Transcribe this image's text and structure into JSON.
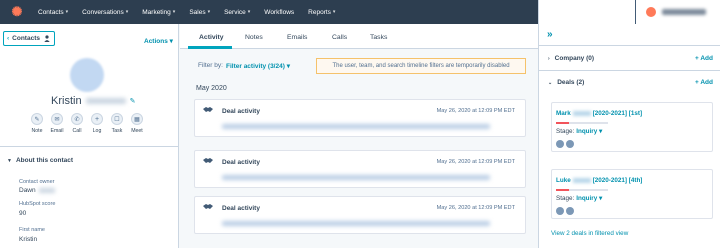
{
  "nav": {
    "logo_glyph": "✺",
    "items": [
      {
        "label": "Contacts",
        "caret": "▾"
      },
      {
        "label": "Conversations",
        "caret": "▾"
      },
      {
        "label": "Marketing",
        "caret": "▾"
      },
      {
        "label": "Sales",
        "caret": "▾"
      },
      {
        "label": "Service",
        "caret": "▾"
      },
      {
        "label": "Workflows",
        "caret": ""
      },
      {
        "label": "Reports",
        "caret": "▾"
      }
    ],
    "right_icons": [
      "search-icon",
      "marketplace-icon",
      "settings-icon",
      "notifications-icon"
    ]
  },
  "left": {
    "back_label": "Contacts",
    "back_glyph": "‹",
    "actions_label": "Actions ▾",
    "first_name": "Kristin",
    "edit_glyph": "✎",
    "activity_buttons": [
      {
        "label": "Note",
        "icon": "note-icon",
        "glyph": "✎"
      },
      {
        "label": "Email",
        "icon": "email-icon",
        "glyph": "✉"
      },
      {
        "label": "Call",
        "icon": "call-icon",
        "glyph": "✆"
      },
      {
        "label": "Log",
        "icon": "log-icon",
        "glyph": "+"
      },
      {
        "label": "Task",
        "icon": "task-icon",
        "glyph": "☐"
      },
      {
        "label": "Meet",
        "icon": "meeting-icon",
        "glyph": "▦"
      }
    ],
    "section_title": "About this contact",
    "section_glyph": "▼",
    "properties": [
      {
        "label": "Contact owner",
        "value": "Dawn"
      },
      {
        "label": "HubSpot score",
        "value": "90"
      },
      {
        "label": "First name",
        "value": "Kristin"
      }
    ]
  },
  "middle": {
    "tabs": [
      "Activity",
      "Notes",
      "Emails",
      "Calls",
      "Tasks"
    ],
    "filter_label": "Filter by:",
    "filter_value": "Filter activity (3/24) ▾",
    "notice": "The user, team, and search timeline filters are temporarily disabled",
    "month": "May 2020",
    "activities": [
      {
        "title": "Deal activity",
        "date": "May 26, 2020 at 12:09 PM EDT"
      },
      {
        "title": "Deal activity",
        "date": "May 26, 2020 at 12:09 PM EDT"
      },
      {
        "title": "Deal activity",
        "date": "May 26, 2020 at 12:09 PM EDT"
      }
    ]
  },
  "right": {
    "expand_glyph": "»",
    "company": {
      "title": "Company (0)",
      "add": "+ Add",
      "glyph": "›"
    },
    "deals": {
      "title": "Deals (2)",
      "add": "+ Add",
      "glyph": "⌄"
    },
    "deal_items": [
      {
        "name_start": "Mark",
        "name_end": "[2020-2021] [1st]",
        "stage_label": "Stage:",
        "stage_value": "Inquiry ▾",
        "progress": 0.25
      },
      {
        "name_start": "Luke",
        "name_end": "[2020-2021] [4th]",
        "stage_label": "Stage:",
        "stage_value": "Inquiry ▾",
        "progress": 0.25
      }
    ],
    "view_deals": "View 2 deals in filtered view"
  },
  "colors": {
    "nav_bg": "#2d3e50",
    "accent": "#00a4bd",
    "link": "#0091ae",
    "brand": "#ff7a59",
    "notice_border": "#f5c26b",
    "stage_bar": "#f2545b"
  }
}
